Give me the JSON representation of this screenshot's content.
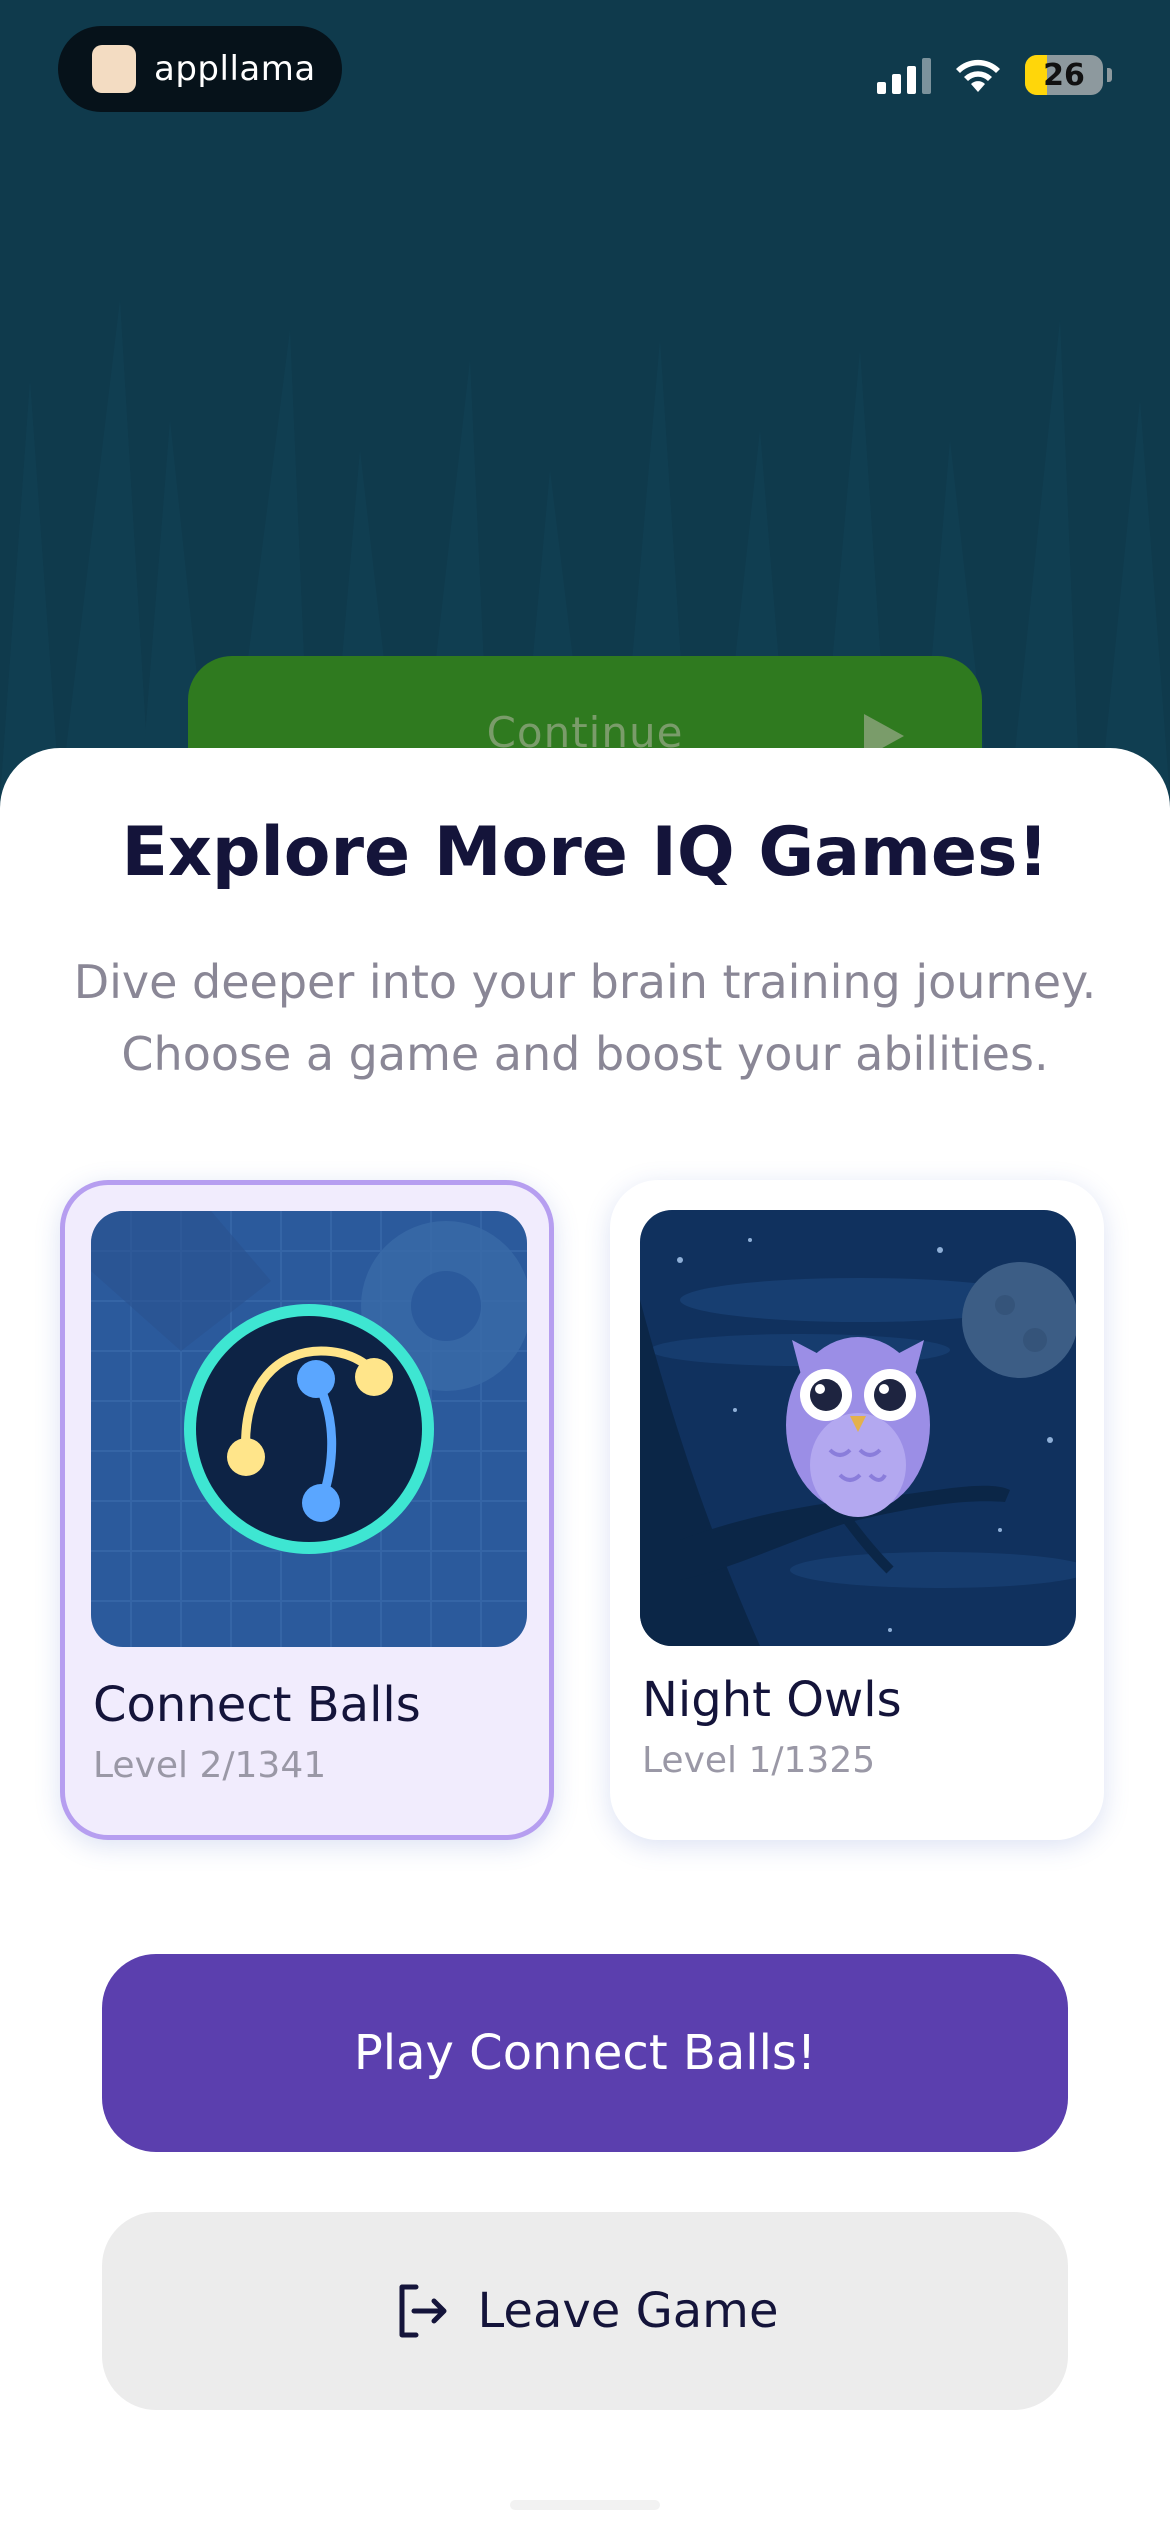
{
  "status_bar": {
    "brand": "appllama",
    "battery_level": "26"
  },
  "background": {
    "continue_label": "Continue"
  },
  "sheet": {
    "title": "Explore More IQ Games!",
    "subtitle": "Dive deeper into your brain training journey. Choose a game and boost your abilities."
  },
  "games": [
    {
      "name": "Connect Balls",
      "level": "Level 2/1341",
      "selected": true,
      "icon": "connect-balls-icon"
    },
    {
      "name": "Night Owls",
      "level": "Level 1/1325",
      "selected": false,
      "icon": "owl-icon"
    }
  ],
  "actions": {
    "play_label": "Play Connect Balls!",
    "leave_label": "Leave Game",
    "leave_icon": "exit-icon"
  },
  "colors": {
    "background": "#0f3a4c",
    "continue_green": "#2f7a1f",
    "primary_purple": "#5b3fae",
    "selected_card_bg": "#f1ecfd",
    "selected_card_border": "#b69ef0",
    "title": "#14143a"
  }
}
